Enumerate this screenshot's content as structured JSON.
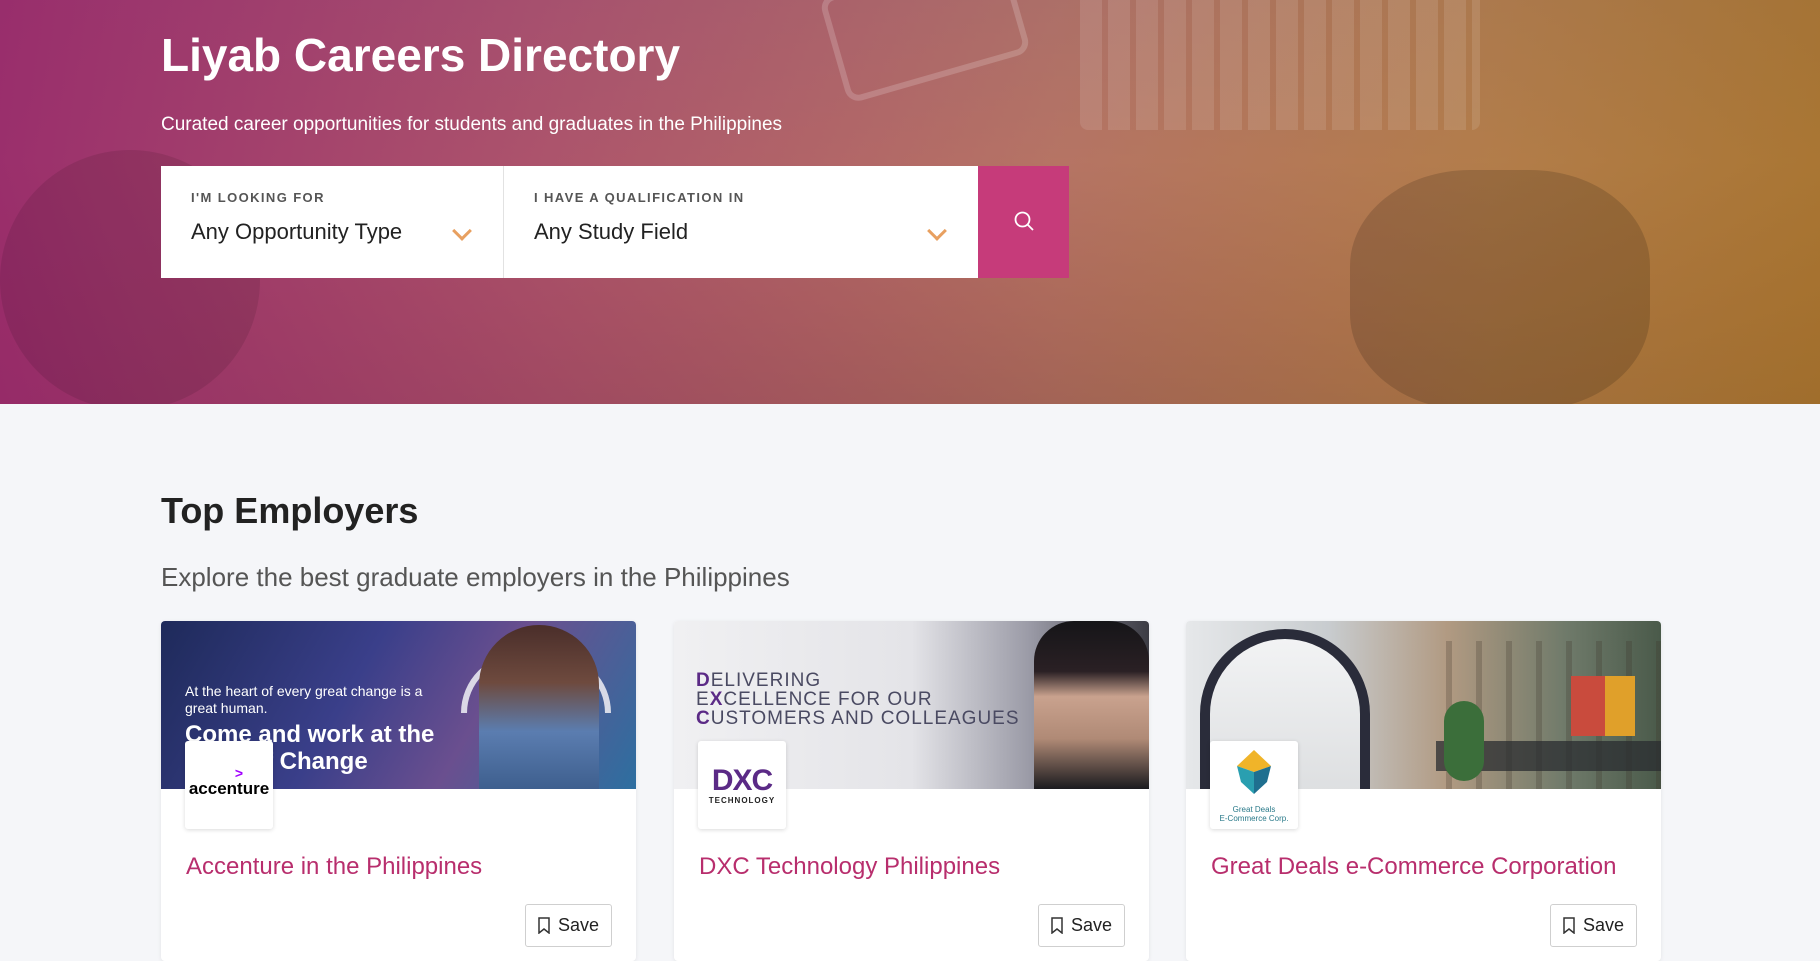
{
  "hero": {
    "title": "Liyab Careers Directory",
    "subtitle": "Curated career opportunities for students and graduates in the Philippines"
  },
  "search": {
    "type_label": "I'M LOOKING FOR",
    "type_value": "Any Opportunity Type",
    "study_label": "I HAVE A QUALIFICATION IN",
    "study_value": "Any Study Field",
    "button_icon": "search-icon"
  },
  "employers": {
    "title": "Top Employers",
    "subtitle": "Explore the best graduate employers in the Philippines",
    "cards": [
      {
        "name": "Accenture in the Philippines",
        "logo_text": "accenture",
        "logo_mark": ">",
        "banner_small": "At the heart of every great change is a great human.",
        "banner_big": "Come and work at the heart of Change",
        "save_label": "Save"
      },
      {
        "name": "DXC Technology Philippines",
        "logo_text": "DXC",
        "logo_sub": "TECHNOLOGY",
        "banner_line1_first": "D",
        "banner_line1_rest": "ELIVERING",
        "banner_line2_first": "E",
        "banner_line2_mid": "X",
        "banner_line2_rest": "CELLENCE FOR OUR",
        "banner_line3_first": "C",
        "banner_line3_rest": "USTOMERS AND COLLEAGUES",
        "save_label": "Save"
      },
      {
        "name": "Great Deals e-Commerce Corporation",
        "logo_caption_1": "Great Deals",
        "logo_caption_2": "E-Commerce Corp.",
        "save_label": "Save"
      }
    ]
  },
  "colors": {
    "accent": "#c63b7a",
    "title": "#b82e6d",
    "chevron": "#e8a060"
  }
}
